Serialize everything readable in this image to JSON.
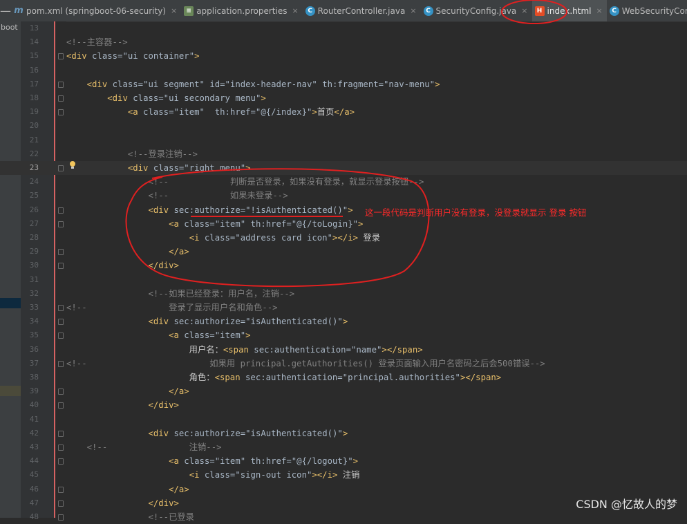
{
  "tabs": [
    {
      "label": "pom.xml (springboot-06-security)",
      "icon": "maven-m-icon",
      "active": false
    },
    {
      "label": "application.properties",
      "icon": "properties-icon",
      "active": false
    },
    {
      "label": "RouterController.java",
      "icon": "java-class-icon",
      "active": false
    },
    {
      "label": "SecurityConfig.java",
      "icon": "java-class-icon",
      "active": false
    },
    {
      "label": "index.html",
      "icon": "html-file-icon",
      "active": true
    },
    {
      "label": "WebSecurityConfigurerAdap",
      "icon": "java-class-icon",
      "active": false
    }
  ],
  "project_label": "gboot",
  "annotation_text": "这一段代码是判断用户没有登录，没登录就显示 登录 按钮",
  "watermark": "CSDN @忆故人的梦",
  "current_line": 23,
  "lines": [
    {
      "n": 13,
      "text": "    "
    },
    {
      "n": 14,
      "text": "<!--主容器-->"
    },
    {
      "n": 15,
      "text": "<div class=\"ui container\">"
    },
    {
      "n": 16,
      "text": ""
    },
    {
      "n": 17,
      "text": "    <div class=\"ui segment\" id=\"index-header-nav\" th:fragment=\"nav-menu\">"
    },
    {
      "n": 18,
      "text": "        <div class=\"ui secondary menu\">"
    },
    {
      "n": 19,
      "text": "            <a class=\"item\"  th:href=\"@{/index}\">首页</a>"
    },
    {
      "n": 20,
      "text": ""
    },
    {
      "n": 21,
      "text": ""
    },
    {
      "n": 22,
      "text": "            <!--登录注销-->"
    },
    {
      "n": 23,
      "text": "            <div class=\"right menu\">"
    },
    {
      "n": 24,
      "text": "                <!--            判断是否登录，如果没有登录，就显示登录按钮-->"
    },
    {
      "n": 25,
      "text": "                <!--            如果未登录-->"
    },
    {
      "n": 26,
      "text": "                <div sec:authorize=\"!isAuthenticated()\">"
    },
    {
      "n": 27,
      "text": "                    <a class=\"item\" th:href=\"@{/toLogin}\">"
    },
    {
      "n": 28,
      "text": "                        <i class=\"address card icon\"></i> 登录"
    },
    {
      "n": 29,
      "text": "                    </a>"
    },
    {
      "n": 30,
      "text": "                </div>"
    },
    {
      "n": 31,
      "text": ""
    },
    {
      "n": 32,
      "text": "                <!--如果已经登录：用户名，注销-->"
    },
    {
      "n": 33,
      "text": "<!--                登录了显示用户名和角色-->"
    },
    {
      "n": 34,
      "text": "                <div sec:authorize=\"isAuthenticated()\">"
    },
    {
      "n": 35,
      "text": "                    <a class=\"item\">"
    },
    {
      "n": 36,
      "text": "                        用户名：<span sec:authentication=\"name\"></span>"
    },
    {
      "n": 37,
      "text": "<!--                        如果用 principal.getAuthorities() 登录页面输入用户名密码之后会500错误-->"
    },
    {
      "n": 38,
      "text": "                        角色：<span sec:authentication=\"principal.authorities\"></span>"
    },
    {
      "n": 39,
      "text": "                    </a>"
    },
    {
      "n": 40,
      "text": "                </div>"
    },
    {
      "n": 41,
      "text": ""
    },
    {
      "n": 42,
      "text": "                <div sec:authorize=\"isAuthenticated()\">"
    },
    {
      "n": 43,
      "text": "    <!--                注销-->"
    },
    {
      "n": 44,
      "text": "                    <a class=\"item\" th:href=\"@{/logout}\">"
    },
    {
      "n": 45,
      "text": "                        <i class=\"sign-out icon\"></i> 注销"
    },
    {
      "n": 46,
      "text": "                    </a>"
    },
    {
      "n": 47,
      "text": "                </div>"
    },
    {
      "n": 48,
      "text": "                <!--已登录"
    }
  ]
}
